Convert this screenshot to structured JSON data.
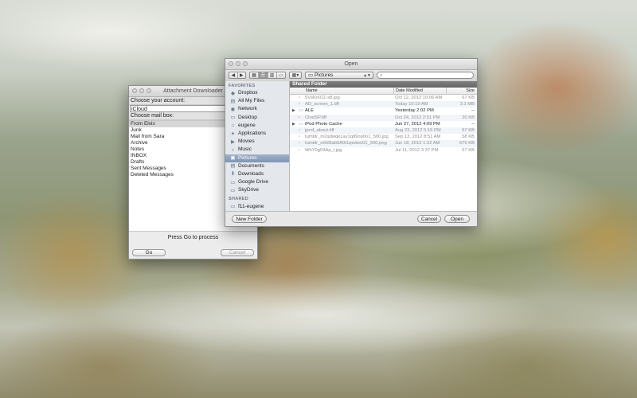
{
  "attachment_downloader": {
    "title": "Attachment Downloader",
    "account_label": "Choose your account:",
    "account_value": "iCloud",
    "mailbox_label": "Choose mail box:",
    "mailboxes": [
      "From Elvis",
      "Junk",
      "Mail from Sara",
      "Archive",
      "Notes",
      "INBOX",
      "Drafts",
      "Sent Messages",
      "Deleted Messages"
    ],
    "selected_mailbox": "From Elvis",
    "status": "Press Go to process",
    "go_label": "Go",
    "cancel_label": "Cancel"
  },
  "open_dialog": {
    "title": "Open",
    "path_popup": "Pictures",
    "sidebar": {
      "favorites_label": "FAVORITES",
      "items": [
        {
          "label": "Dropbox",
          "icon": "dropbox-icon"
        },
        {
          "label": "All My Files",
          "icon": "all-files-icon"
        },
        {
          "label": "Network",
          "icon": "network-icon"
        },
        {
          "label": "Desktop",
          "icon": "desktop-icon"
        },
        {
          "label": "eugene",
          "icon": "home-icon"
        },
        {
          "label": "Applications",
          "icon": "applications-icon"
        },
        {
          "label": "Movies",
          "icon": "movies-icon"
        },
        {
          "label": "Music",
          "icon": "music-icon"
        },
        {
          "label": "Pictures",
          "icon": "pictures-icon",
          "selected": true
        },
        {
          "label": "Documents",
          "icon": "documents-icon"
        },
        {
          "label": "Downloads",
          "icon": "downloads-icon"
        },
        {
          "label": "Google Drive",
          "icon": "folder-icon"
        },
        {
          "label": "SkyDrive",
          "icon": "folder-icon"
        }
      ],
      "shared_label": "SHARED",
      "shared_items": [
        {
          "label": "f11-eugene",
          "icon": "computer-icon"
        }
      ]
    },
    "file_pane": {
      "header": "Shared Folder",
      "columns": {
        "name": "Name",
        "date": "Date Modified",
        "size": "Size"
      },
      "files": [
        {
          "name": "5VsKn011-x8.jpg",
          "date": "Oct 12, 2012 10:06 AM",
          "size": "67 KB",
          "folder": false,
          "dim": true
        },
        {
          "name": "AD_screen_1.tiff",
          "date": "Today 10:19 AM",
          "size": "3.1 MB",
          "folder": false,
          "dim": true
        },
        {
          "name": "ALE",
          "date": "Yesterday 2:02 PM",
          "size": "--",
          "folder": true,
          "dim": false
        },
        {
          "name": "ChatSP.tiff",
          "date": "Oct 24, 2012 2:51 PM",
          "size": "20 KB",
          "folder": false,
          "dim": true
        },
        {
          "name": "iPod Photo Cache",
          "date": "Jun 27, 2012 4:09 PM",
          "size": "--",
          "folder": true,
          "dim": false
        },
        {
          "name": "jprof_about.tiff",
          "date": "Aug 23, 2012 5:15 PM",
          "size": "57 KB",
          "folder": false,
          "dim": true
        },
        {
          "name": "tumblr_m2qdwqk1ay1qd9op0o1_500.jpg",
          "date": "Sep 13, 2012 8:51 AM",
          "size": "58 KB",
          "folder": false,
          "dim": true
        },
        {
          "name": "tumblr_m5t9lab5A0t1qedwo01_500.png",
          "date": "Jun 18, 2012 1:32 AM",
          "size": "675 KB",
          "folder": false,
          "dim": true
        },
        {
          "name": "WhY0g59Ap_l.jpg",
          "date": "Jul 11, 2012 3:37 PM",
          "size": "67 KB",
          "folder": false,
          "dim": true
        }
      ]
    },
    "new_folder_label": "New Folder",
    "cancel_label": "Cancel",
    "open_label": "Open"
  }
}
